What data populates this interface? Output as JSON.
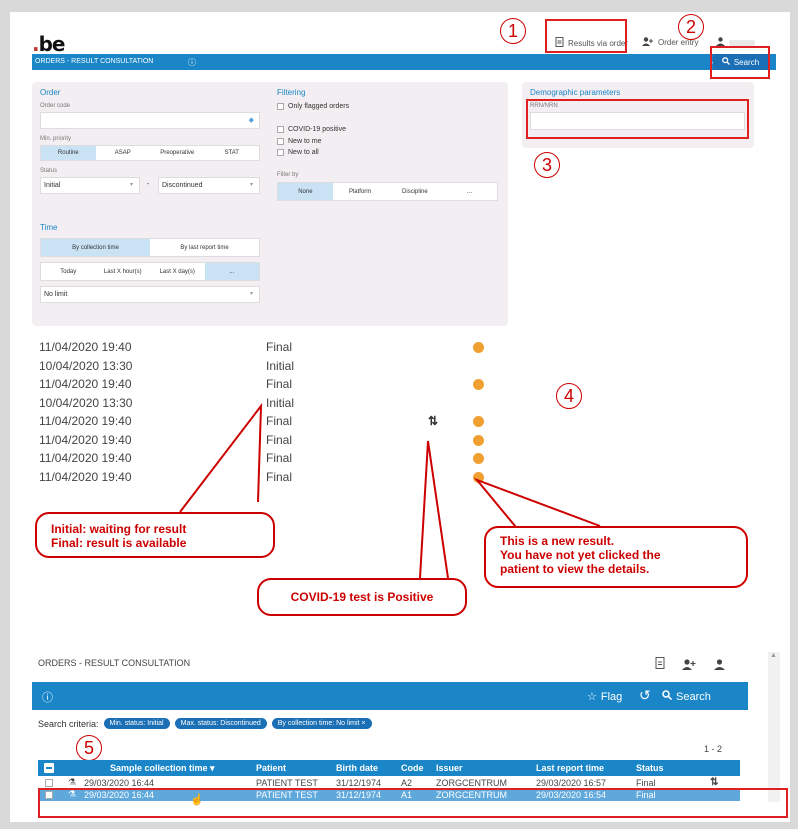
{
  "header": {
    "logo": "be",
    "nav": [
      {
        "label": "Results via order",
        "icon": "document-icon"
      },
      {
        "label": "Order entry",
        "icon": "add-user-icon"
      },
      {
        "label": "",
        "icon": "user-icon"
      }
    ]
  },
  "title_bar": {
    "title": "ORDERS - RESULT CONSULTATION",
    "search_label": "Search"
  },
  "order": {
    "title": "Order",
    "order_code_label": "Order code",
    "min_priority_label": "Min. priority",
    "priorities": [
      "Routine",
      "ASAP",
      "Preoperative",
      "STAT"
    ],
    "status_label": "Status",
    "status_from": "Initial",
    "status_separator": "-",
    "status_to": "Discontinued"
  },
  "filtering": {
    "title": "Filtering",
    "checks": [
      "Only flagged orders",
      "COVID-19 positive",
      "New to me",
      "New to all"
    ],
    "filter_by_label": "Filter by",
    "filter_by": [
      "None",
      "Platform",
      "Discipline",
      "..."
    ]
  },
  "time": {
    "title": "Time",
    "modes": [
      "By collection time",
      "By last report time"
    ],
    "ranges": [
      "Today",
      "Last X hour(s)",
      "Last X day(s)",
      "..."
    ],
    "limit": "No limit"
  },
  "demographic": {
    "title": "Demographic parameters",
    "rrn_label": "RRN/NRN"
  },
  "results": [
    {
      "time": "11/04/2020 19:40",
      "status": "Final",
      "bell": true,
      "covid": false
    },
    {
      "time": "10/04/2020 13:30",
      "status": "Initial",
      "bell": false,
      "covid": false
    },
    {
      "time": "11/04/2020 19:40",
      "status": "Final",
      "bell": true,
      "covid": false
    },
    {
      "time": "10/04/2020 13:30",
      "status": "Initial",
      "bell": false,
      "covid": false
    },
    {
      "time": "11/04/2020 19:40",
      "status": "Final",
      "bell": true,
      "covid": true
    },
    {
      "time": "11/04/2020 19:40",
      "status": "Final",
      "bell": true,
      "covid": false
    },
    {
      "time": "11/04/2020 19:40",
      "status": "Final",
      "bell": true,
      "covid": false
    },
    {
      "time": "11/04/2020 19:40",
      "status": "Final",
      "bell": true,
      "covid": false
    }
  ],
  "callouts": {
    "numbers": [
      "1",
      "2",
      "3",
      "4",
      "5"
    ],
    "status_note_1": "Initial: waiting for result",
    "status_note_2": "Final: result is available",
    "covid_note": "COVID-19 test is Positive",
    "new_note_1": "This is a new result.",
    "new_note_2": "You have not yet clicked the",
    "new_note_3": "patient to view the details."
  },
  "lower": {
    "title": "ORDERS - RESULT CONSULTATION",
    "flag_label": "Flag",
    "search_label": "Search",
    "criteria_label": "Search criteria:",
    "chips": [
      "Min. status: Initial",
      "Max. status: Discontinued",
      "By collection time: No limit"
    ],
    "chip_close": "×",
    "pagination": "1 - 2",
    "columns": [
      "Sample collection time ▾",
      "Patient",
      "Birth date",
      "Code",
      "Issuer",
      "Last report time",
      "Status"
    ],
    "rows": [
      {
        "time": "29/03/2020 16:44",
        "patient": "PATIENT TEST",
        "birth": "31/12/1974",
        "code": "A2",
        "issuer": "ZORGCENTRUM",
        "last": "29/03/2020 16:57",
        "status": "Final",
        "covid": true
      },
      {
        "time": "29/03/2020 16:44",
        "patient": "PATIENT TEST",
        "birth": "31/12/1974",
        "code": "A1",
        "issuer": "ZORGCENTRUM",
        "last": "29/03/2020 16:54",
        "status": "Final",
        "covid": false
      }
    ]
  },
  "colors": {
    "accent": "#1a86c8",
    "callout_red": "#cc0000",
    "bell": "#f0a030",
    "panel": "#f3eef1"
  }
}
